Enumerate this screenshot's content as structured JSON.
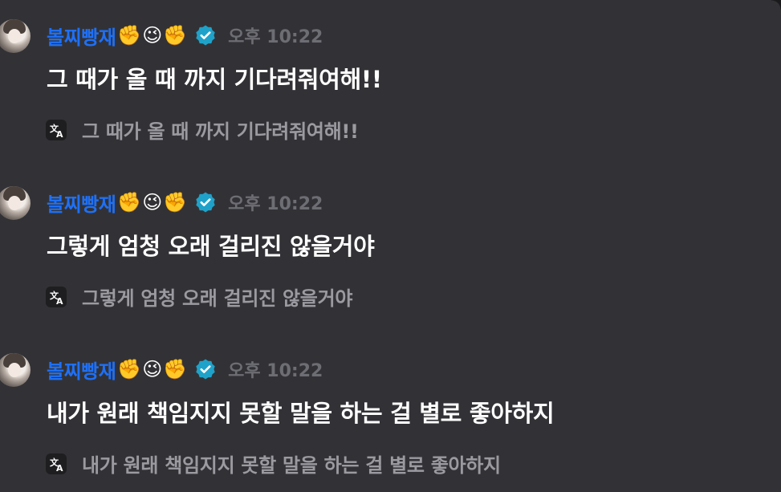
{
  "messages": [
    {
      "author": "볼찌빵재",
      "emojis": [
        "✊",
        "😉",
        "✊"
      ],
      "verified_icon": "verified-badge-icon",
      "timestamp": "오후 10:22",
      "content": "그 때가 올 때 까지 기다려줘여해!!",
      "translation": "그 때가 올 때 까지 기다려줘여해!!"
    },
    {
      "author": "볼찌빵재",
      "emojis": [
        "✊",
        "😉",
        "✊"
      ],
      "verified_icon": "verified-badge-icon",
      "timestamp": "오후 10:22",
      "content": "그렇게 엄청 오래 걸리진 않을거야",
      "translation": "그렇게 엄청 오래 걸리진 않을거야"
    },
    {
      "author": "볼찌빵재",
      "emojis": [
        "✊",
        "😉",
        "✊"
      ],
      "verified_icon": "verified-badge-icon",
      "timestamp": "오후 10:22",
      "content": "내가 원래 책임지지 못할 말을 하는 걸 별로 좋아하지",
      "translation": "내가 원래 책임지지 못할 말을 하는 걸 별로 좋아하지"
    }
  ],
  "colors": {
    "background": "#323236",
    "author": "#1f70f5",
    "timestamp": "#6d6d74",
    "translation": "#9a9aa0",
    "verified": "#1fa2c9"
  }
}
